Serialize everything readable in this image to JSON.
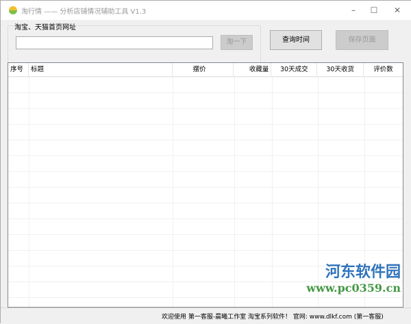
{
  "window": {
    "title": "淘行情 —— 分析店铺情况辅助工具 V1.3",
    "minimize": "–",
    "maximize": "☐",
    "close": "✕"
  },
  "group": {
    "label": "淘宝、天猫首页网址",
    "url_value": "",
    "search_button": "淘一下"
  },
  "buttons": {
    "query_time": "查询时间",
    "save_page": "保存页面"
  },
  "table": {
    "columns": [
      "序号",
      "标题",
      "摆价",
      "收藏量",
      "30天成交",
      "30天收货",
      "评价数"
    ],
    "rows": []
  },
  "status": {
    "text": "欢迎使用 第一客服-晨曦工作室 淘宝系列软件！ 官网: www.dlkf.com (第一客服)"
  },
  "watermark": {
    "name": "河东软件园",
    "url": "www.pc0359.cn"
  }
}
